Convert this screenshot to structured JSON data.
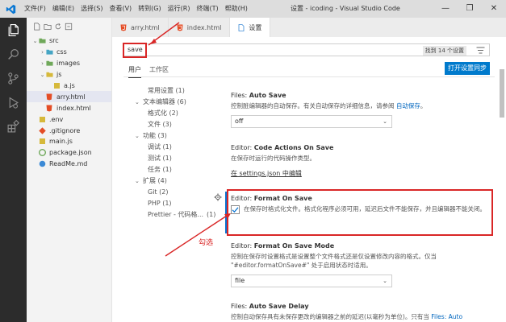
{
  "window": {
    "title": "设置 - icoding - Visual Studio Code",
    "menu": [
      "文件(F)",
      "编辑(E)",
      "选择(S)",
      "查看(V)",
      "转到(G)",
      "运行(R)",
      "终端(T)",
      "帮助(H)"
    ],
    "controls": [
      "—",
      "❐",
      "✕"
    ]
  },
  "explorer": {
    "items": [
      {
        "label": "src",
        "indent": 0,
        "chevron": "v",
        "icon": "folder",
        "color": "#6fa85a"
      },
      {
        "label": "css",
        "indent": 1,
        "chevron": ">",
        "icon": "folder",
        "color": "#45a5c4"
      },
      {
        "label": "images",
        "indent": 1,
        "chevron": ">",
        "icon": "folder",
        "color": "#6fa85a"
      },
      {
        "label": "js",
        "indent": 1,
        "chevron": "v",
        "icon": "folder",
        "color": "#d6b93b"
      },
      {
        "label": "a.js",
        "indent": 2,
        "chevron": "",
        "icon": "js",
        "color": "#d6b93b"
      },
      {
        "label": "arry.html",
        "indent": 1,
        "chevron": "",
        "icon": "html",
        "color": "#e44d26",
        "selected": true
      },
      {
        "label": "index.html",
        "indent": 1,
        "chevron": "",
        "icon": "html",
        "color": "#e44d26"
      },
      {
        "label": ".env",
        "indent": 0,
        "chevron": "",
        "icon": "env",
        "color": "#d6b93b"
      },
      {
        "label": ".gitignore",
        "indent": 0,
        "chevron": "",
        "icon": "git",
        "color": "#e44d26"
      },
      {
        "label": "main.js",
        "indent": 0,
        "chevron": "",
        "icon": "js",
        "color": "#d6b93b"
      },
      {
        "label": "package.json",
        "indent": 0,
        "chevron": "",
        "icon": "json",
        "color": "#6fa85a"
      },
      {
        "label": "ReadMe.md",
        "indent": 0,
        "chevron": "",
        "icon": "md",
        "color": "#3c8ad6"
      }
    ]
  },
  "tabs": [
    {
      "label": "arry.html",
      "active": false
    },
    {
      "label": "index.html",
      "active": false
    },
    {
      "label": "设置",
      "active": true
    }
  ],
  "settings": {
    "search_value": "save",
    "found_badge": "找到 14 个设置",
    "scope_tabs": [
      "用户",
      "工作区"
    ],
    "sync_button": "打开设置同步",
    "toc": [
      {
        "label": "常用设置 (1)",
        "indent": 1,
        "chevron": ""
      },
      {
        "label": "文本编辑器 (6)",
        "indent": 0,
        "chevron": "v"
      },
      {
        "label": "格式化 (2)",
        "indent": 1,
        "chevron": ""
      },
      {
        "label": "文件 (3)",
        "indent": 1,
        "chevron": ""
      },
      {
        "label": "功能 (3)",
        "indent": 0,
        "chevron": "v"
      },
      {
        "label": "调试 (1)",
        "indent": 1,
        "chevron": ""
      },
      {
        "label": "测试 (1)",
        "indent": 1,
        "chevron": ""
      },
      {
        "label": "任务 (1)",
        "indent": 1,
        "chevron": ""
      },
      {
        "label": "扩展 (4)",
        "indent": 0,
        "chevron": "v"
      },
      {
        "label": "Git (2)",
        "indent": 1,
        "chevron": ""
      },
      {
        "label": "PHP (1)",
        "indent": 1,
        "chevron": ""
      },
      {
        "label": "Prettier - 代码格...",
        "indent": 1,
        "chevron": "",
        "count": "(1)"
      }
    ],
    "auto_save": {
      "category": "Files: ",
      "name": "Auto Save",
      "desc": "控制脏编辑器的自动保存。有关自动保存的详细信息，请参阅",
      "link": "自动保存",
      "link_after": "。",
      "value": "off"
    },
    "code_actions": {
      "category": "Editor: ",
      "name": "Code Actions On Save",
      "desc": "在保存时运行的代码操作类型。",
      "edit_link": "在 settings.json 中编辑"
    },
    "format_on_save": {
      "category": "Editor: ",
      "name": "Format On Save",
      "desc": "在保存时格式化文件。格式化程序必须可用，延迟后文件不能保存，并且编辑器不能关闭。",
      "checked": true
    },
    "format_on_save_mode": {
      "category": "Editor: ",
      "name": "Format On Save Mode",
      "desc": "控制在保存时设置格式是设置整个文件格式还是仅设置修改内容的格式。仅当 \"#editor.formatOnSave#\" 处于启用状态时适用。",
      "value": "file"
    },
    "auto_save_delay": {
      "category": "Files: ",
      "name": "Auto Save Delay",
      "desc": "控制自动保存具有未保存更改的编辑器之前的延迟(以毫秒为单位)。只有当",
      "link": "Files: Auto"
    }
  },
  "annotation": {
    "label": "勾选",
    "color": "#d92626"
  }
}
